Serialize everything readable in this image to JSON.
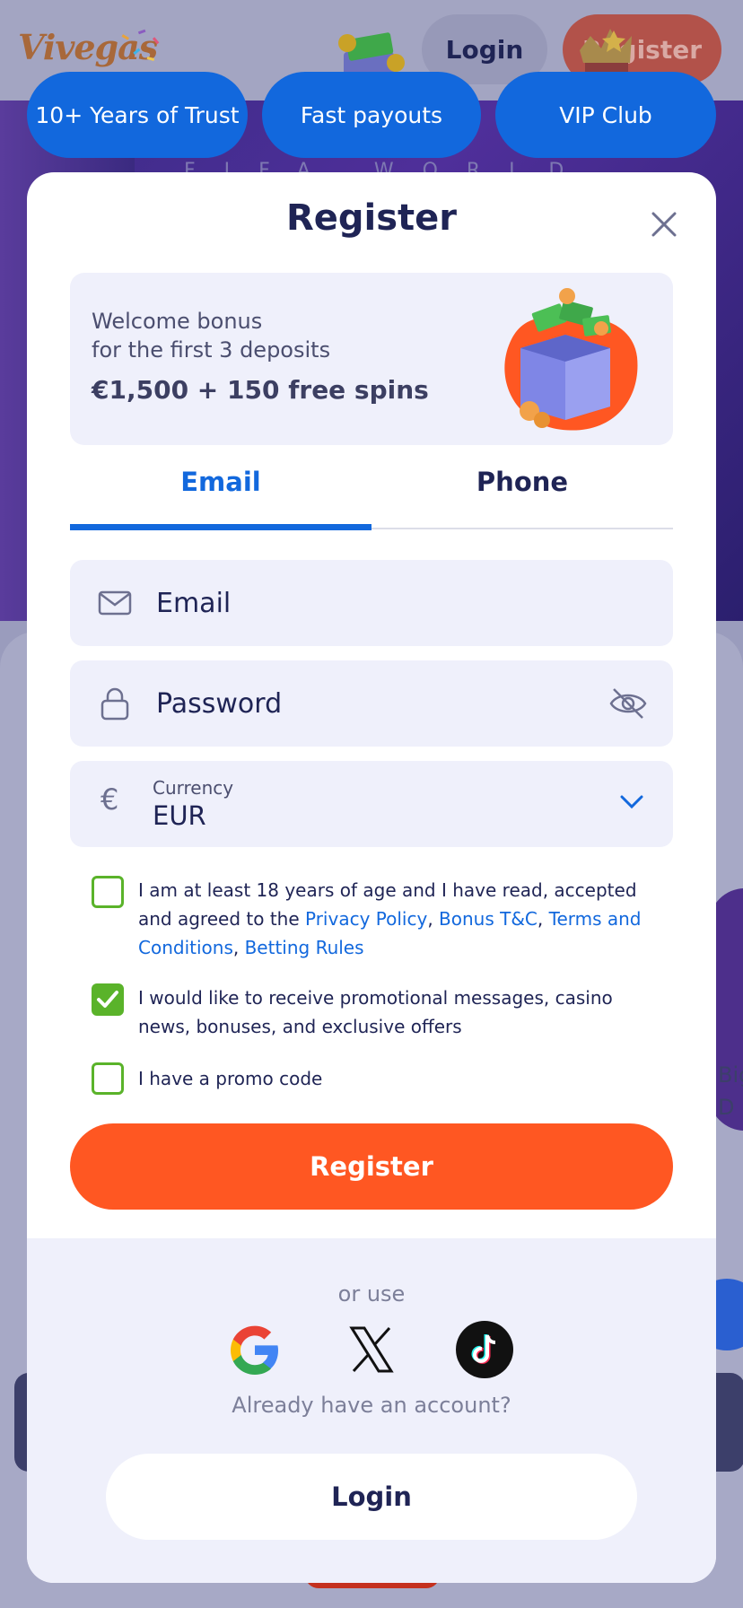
{
  "header": {
    "logo_text": "Vivegas",
    "login_label": "Login",
    "register_label": "Register"
  },
  "pills": [
    {
      "label": "10+ Years of Trust"
    },
    {
      "label": "Fast payouts"
    },
    {
      "label": "VIP Club"
    }
  ],
  "background": {
    "hero_subtitle": "FIFA WORLD CUP",
    "side_text": "Big\nD"
  },
  "modal": {
    "title": "Register",
    "bonus": {
      "line1": "Welcome bonus",
      "line2": "for the first 3 deposits",
      "amount": "€1,500 + 150 free spins"
    },
    "tabs": [
      {
        "label": "Email",
        "active": true
      },
      {
        "label": "Phone",
        "active": false
      }
    ],
    "email_placeholder": "Email",
    "password_placeholder": "Password",
    "currency": {
      "symbol": "€",
      "label": "Currency",
      "value": "EUR"
    },
    "checkboxes": {
      "age": {
        "checked": false,
        "text_start": "I am at least 18 years of age and I have read, accepted and agreed to the ",
        "privacy": "Privacy Policy",
        "bonus_tc": "Bonus T&C",
        "terms": "Terms and Conditions",
        "betting": "Betting Rules",
        "sep1": ", ",
        "sep2": ", ",
        "sep3": ", "
      },
      "promo_messages": {
        "checked": true,
        "text": "I would like to receive promotional messages, casino news, bonuses, and exclusive offers"
      },
      "promo_code": {
        "checked": false,
        "text": "I have a promo code"
      }
    },
    "register_button": "Register",
    "or_use": "or use",
    "social": [
      "google-icon",
      "x-icon",
      "tiktok-icon"
    ],
    "already": "Already have an account?",
    "login_button": "Login"
  },
  "colors": {
    "accent_blue": "#1268dd",
    "register_orange": "#ff5722",
    "checkbox_green": "#5ab32a",
    "text_dark": "#1f2455"
  }
}
